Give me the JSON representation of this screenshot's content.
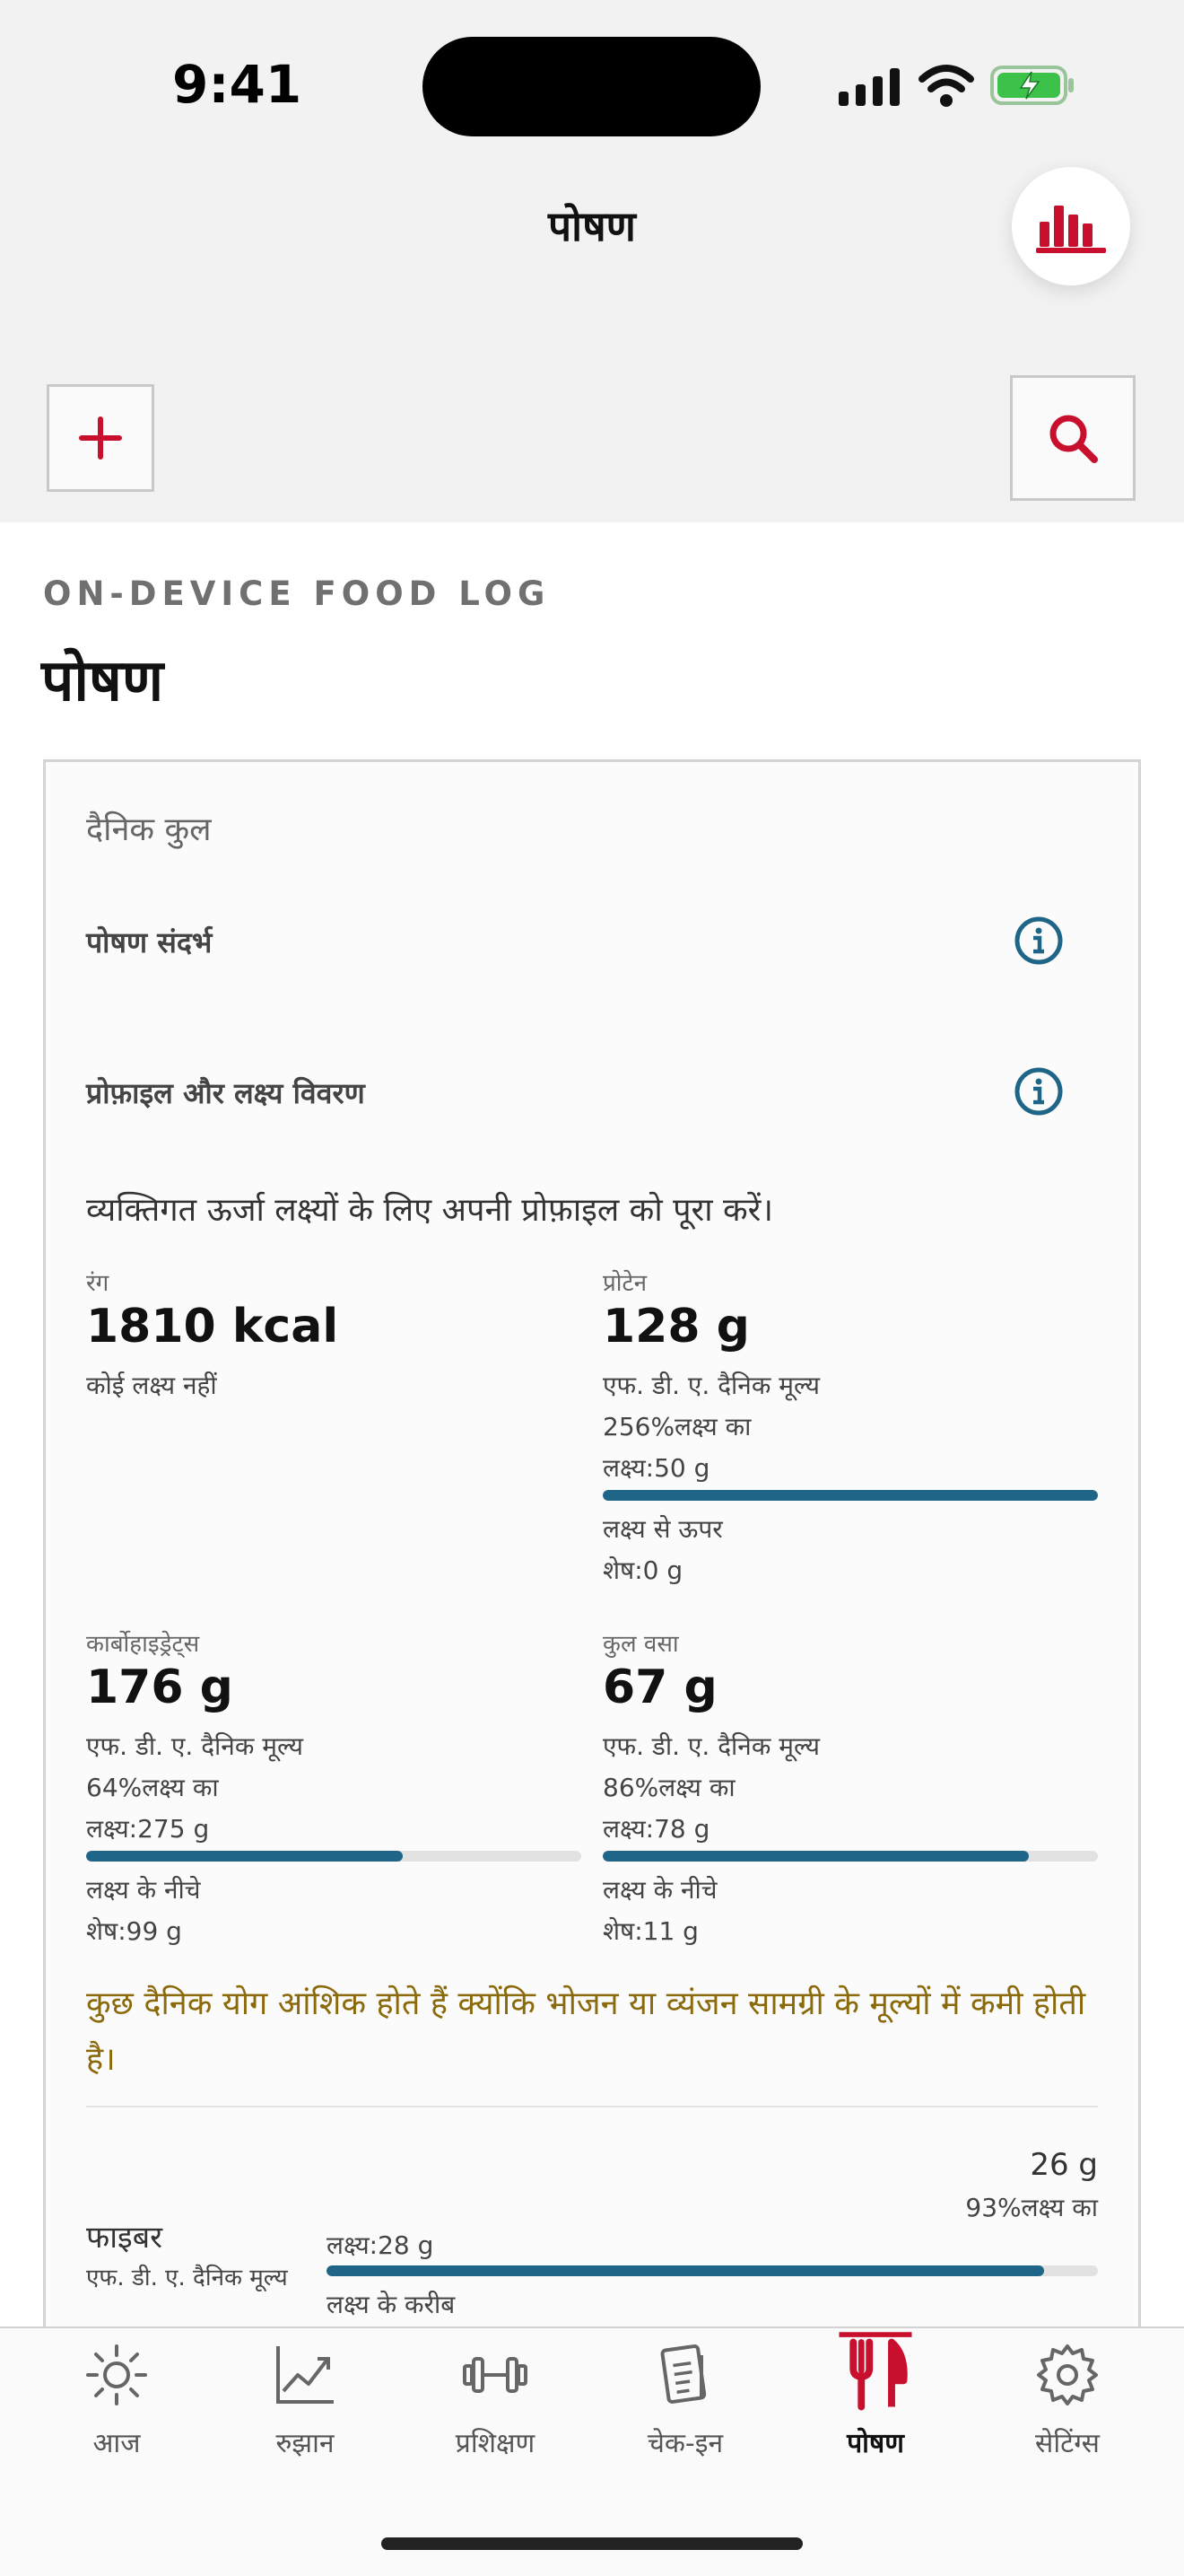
{
  "status_bar": {
    "time": "9:41"
  },
  "header": {
    "title": "पोषण"
  },
  "page": {
    "eyebrow": "ON-DEVICE FOOD LOG",
    "title": "पोषण"
  },
  "daily": {
    "title": "दैनिक कुल",
    "nutrition_reference": "पोषण संदर्भ",
    "profile_goals": "प्रोफ़ाइल और लक्ष्य विवरण",
    "profile_note": "व्यक्तिगत ऊर्जा लक्ष्यों के लिए अपनी प्रोफ़ाइल को पूरा करें।",
    "metrics": {
      "calories": {
        "label": "रंग",
        "value": "1810 kcal",
        "note": "कोई लक्ष्य नहीं"
      },
      "protein": {
        "label": "प्रोटेन",
        "value": "128 g",
        "fda": "एफ. डी. ए. दैनिक मूल्य",
        "percent": "256%लक्ष्य का",
        "target": "लक्ष्य:50 g",
        "progress": 1.0,
        "status": "लक्ष्य से ऊपर",
        "remaining": "शेष:0 g"
      },
      "carbs": {
        "label": "कार्बोहाइड्रेट्स",
        "value": "176 g",
        "fda": "एफ. डी. ए. दैनिक मूल्य",
        "percent": "64%लक्ष्य का",
        "target": "लक्ष्य:275 g",
        "progress": 0.64,
        "status": "लक्ष्य के नीचे",
        "remaining": "शेष:99 g"
      },
      "fat": {
        "label": "कुल वसा",
        "value": "67 g",
        "fda": "एफ. डी. ए. दैनिक मूल्य",
        "percent": "86%लक्ष्य का",
        "target": "लक्ष्य:78 g",
        "progress": 0.86,
        "status": "लक्ष्य के नीचे",
        "remaining": "शेष:11 g"
      }
    },
    "partial_note": "कुछ दैनिक योग आंशिक होते हैं क्योंकि भोजन या व्यंजन सामग्री के मूल्यों में कमी होती है।",
    "fiber": {
      "label": "फाइबर",
      "fda": "एफ. डी. ए. दैनिक मूल्य",
      "value": "26 g",
      "percent": "93%लक्ष्य का",
      "target": "लक्ष्य:28 g",
      "progress": 0.93,
      "status": "लक्ष्य के करीब"
    }
  },
  "tabs": [
    {
      "label": "आज",
      "icon": "sun-icon"
    },
    {
      "label": "रुझान",
      "icon": "trend-chart-icon"
    },
    {
      "label": "प्रशिक्षण",
      "icon": "dumbbell-icon"
    },
    {
      "label": "चेक-इन",
      "icon": "checklist-icon"
    },
    {
      "label": "पोषण",
      "icon": "fork-knife-icon",
      "active": true
    },
    {
      "label": "सेटिंग्स",
      "icon": "gear-icon"
    }
  ],
  "colors": {
    "accent": "#d0202a",
    "progress": "#1e6587",
    "warning_text": "#8b6a0c"
  }
}
